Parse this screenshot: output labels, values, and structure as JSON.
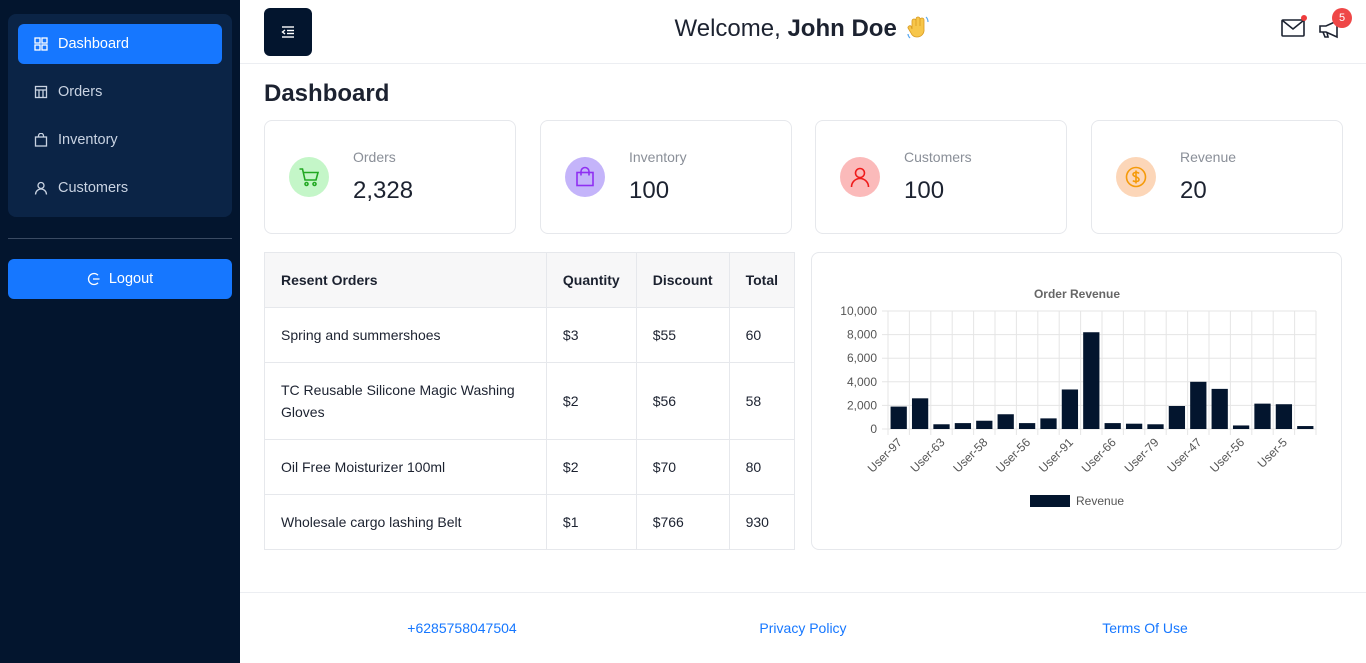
{
  "sidebar": {
    "items": [
      {
        "label": "Dashboard",
        "icon": "dashboard-icon",
        "active": true
      },
      {
        "label": "Orders",
        "icon": "shop-icon"
      },
      {
        "label": "Inventory",
        "icon": "shopping-bag-icon"
      },
      {
        "label": "Customers",
        "icon": "user-icon"
      }
    ],
    "logout_label": "Logout"
  },
  "header": {
    "welcome_prefix": "Welcome, ",
    "user_name": "John Doe",
    "notification_count": "5"
  },
  "page": {
    "title": "Dashboard"
  },
  "cards": [
    {
      "label": "Orders",
      "value": "2,328",
      "icon": "shopping-cart-icon",
      "color": "#22a822",
      "bg": "#c4f6c8"
    },
    {
      "label": "Inventory",
      "value": "100",
      "icon": "shopping-bag-icon",
      "color": "#8f2ff2",
      "bg": "#c4b4fa"
    },
    {
      "label": "Customers",
      "value": "100",
      "icon": "user-icon",
      "color": "#ef1c1c",
      "bg": "#fbbaba"
    },
    {
      "label": "Revenue",
      "value": "20",
      "icon": "dollar-circle-icon",
      "color": "#f59a09",
      "bg": "#fcd6b8"
    }
  ],
  "orders_table": {
    "headers": [
      "Resent Orders",
      "Quantity",
      "Discount",
      "Total"
    ],
    "rows": [
      [
        "Spring and summershoes",
        "$3",
        "$55",
        "60"
      ],
      [
        "TC Reusable Silicone Magic Washing Gloves",
        "$2",
        "$56",
        "58"
      ],
      [
        "Oil Free Moisturizer 100ml",
        "$2",
        "$70",
        "80"
      ],
      [
        "Wholesale cargo lashing Belt",
        "$1",
        "$766",
        "930"
      ]
    ]
  },
  "chart_data": {
    "type": "bar",
    "title": "Order Revenue",
    "xlabel": "",
    "ylabel": "",
    "ylim": [
      0,
      10000
    ],
    "yticks": [
      "0",
      "2,000",
      "4,000",
      "6,000",
      "8,000",
      "10,000"
    ],
    "x_tick_labels": [
      "User-97",
      "User-63",
      "User-58",
      "User-56",
      "User-91",
      "User-66",
      "User-79",
      "User-47",
      "User-56",
      "User-5"
    ],
    "values": [
      1900,
      2600,
      400,
      500,
      700,
      1250,
      500,
      900,
      3350,
      8200,
      500,
      450,
      400,
      1950,
      4000,
      3400,
      300,
      2150,
      2100,
      250
    ],
    "series": [
      {
        "name": "Revenue",
        "color": "#03152e"
      }
    ],
    "legend": "bottom",
    "grid": true
  },
  "footer": {
    "phone": "+6285758047504",
    "privacy": "Privacy Policy",
    "terms": "Terms Of Use"
  },
  "colors": {
    "sidebar_bg": "#03152e",
    "menu_bg": "#0b2446",
    "accent": "#1677ff",
    "badge": "#ef4747"
  }
}
